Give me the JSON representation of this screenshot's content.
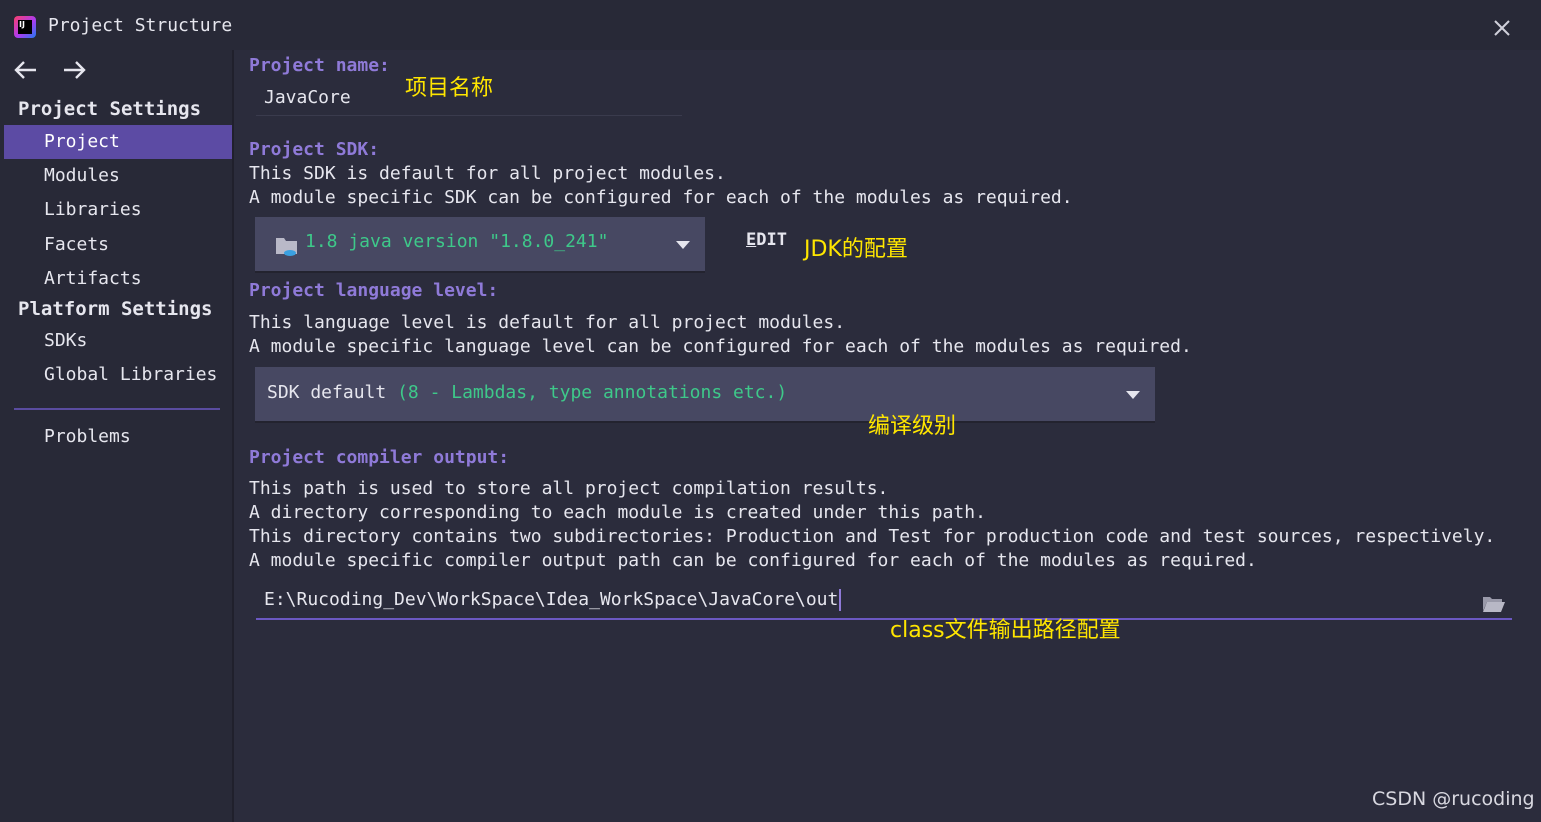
{
  "window": {
    "title": "Project Structure"
  },
  "sidebar": {
    "project_settings_title": "Project Settings",
    "project_settings_items": [
      {
        "label": "Project",
        "selected": true
      },
      {
        "label": "Modules",
        "selected": false
      },
      {
        "label": "Libraries",
        "selected": false
      },
      {
        "label": "Facets",
        "selected": false
      },
      {
        "label": "Artifacts",
        "selected": false
      }
    ],
    "platform_settings_title": "Platform Settings",
    "platform_settings_items": [
      {
        "label": "SDKs"
      },
      {
        "label": "Global Libraries"
      }
    ],
    "problems_label": "Problems"
  },
  "main": {
    "project_name": {
      "label": "Project name:",
      "value": "JavaCore"
    },
    "project_sdk": {
      "label": "Project SDK:",
      "desc_line1": "This SDK is default for all project modules.",
      "desc_line2": "A module specific SDK can be configured for each of the modules as required.",
      "selected": "1.8 java version \"1.8.0_241\"",
      "edit_label_first": "E",
      "edit_label_rest": "DIT"
    },
    "language_level": {
      "label": "Project language level:",
      "desc_line1": "This language level is default for all project modules.",
      "desc_line2": "A module specific language level can be configured for each of the modules as required.",
      "selected_main": "SDK default",
      "selected_detail": "(8 - Lambdas, type annotations etc.)"
    },
    "compiler_output": {
      "label": "Project compiler output:",
      "desc_line1": "This path is used to store all project compilation results.",
      "desc_line2": "A directory corresponding to each module is created under this path.",
      "desc_line3": "This directory contains two subdirectories: Production and Test for production code and test sources, respectively.",
      "desc_line4": "A module specific compiler output path can be configured for each of the modules as required.",
      "value": "E:\\Rucoding_Dev\\WorkSpace\\Idea_WorkSpace\\JavaCore\\out"
    }
  },
  "annotations": {
    "project_name": "项目名称",
    "jdk_config": "JDK的配置",
    "compile_level": "编译级别",
    "class_output": "class文件输出路径配置"
  },
  "watermark": "CSDN @rucoding",
  "colors": {
    "accent": "#8f7ad8",
    "selection": "#5c4ba4",
    "annotation": "#ffe600",
    "green_text": "#3ec98a"
  }
}
